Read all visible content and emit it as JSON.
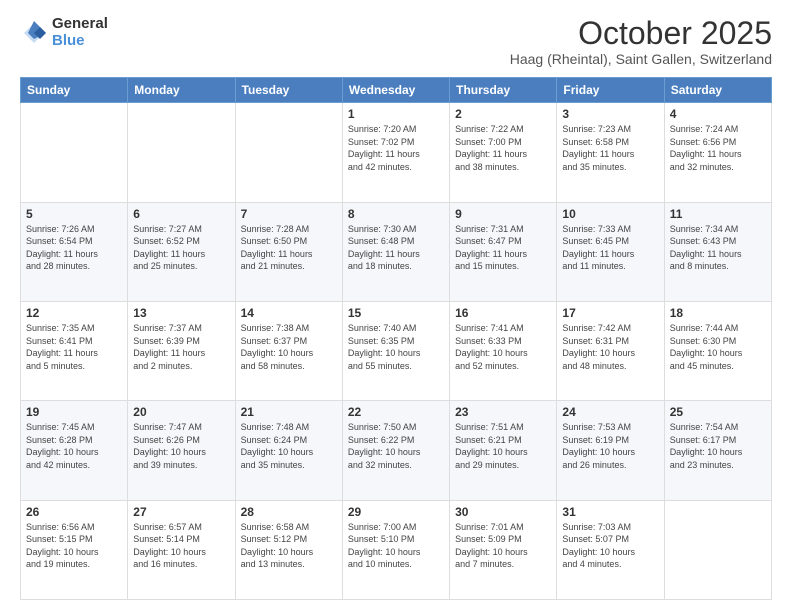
{
  "logo": {
    "general": "General",
    "blue": "Blue"
  },
  "header": {
    "month": "October 2025",
    "location": "Haag (Rheintal), Saint Gallen, Switzerland"
  },
  "weekdays": [
    "Sunday",
    "Monday",
    "Tuesday",
    "Wednesday",
    "Thursday",
    "Friday",
    "Saturday"
  ],
  "weeks": [
    [
      {
        "day": "",
        "info": ""
      },
      {
        "day": "",
        "info": ""
      },
      {
        "day": "",
        "info": ""
      },
      {
        "day": "1",
        "info": "Sunrise: 7:20 AM\nSunset: 7:02 PM\nDaylight: 11 hours\nand 42 minutes."
      },
      {
        "day": "2",
        "info": "Sunrise: 7:22 AM\nSunset: 7:00 PM\nDaylight: 11 hours\nand 38 minutes."
      },
      {
        "day": "3",
        "info": "Sunrise: 7:23 AM\nSunset: 6:58 PM\nDaylight: 11 hours\nand 35 minutes."
      },
      {
        "day": "4",
        "info": "Sunrise: 7:24 AM\nSunset: 6:56 PM\nDaylight: 11 hours\nand 32 minutes."
      }
    ],
    [
      {
        "day": "5",
        "info": "Sunrise: 7:26 AM\nSunset: 6:54 PM\nDaylight: 11 hours\nand 28 minutes."
      },
      {
        "day": "6",
        "info": "Sunrise: 7:27 AM\nSunset: 6:52 PM\nDaylight: 11 hours\nand 25 minutes."
      },
      {
        "day": "7",
        "info": "Sunrise: 7:28 AM\nSunset: 6:50 PM\nDaylight: 11 hours\nand 21 minutes."
      },
      {
        "day": "8",
        "info": "Sunrise: 7:30 AM\nSunset: 6:48 PM\nDaylight: 11 hours\nand 18 minutes."
      },
      {
        "day": "9",
        "info": "Sunrise: 7:31 AM\nSunset: 6:47 PM\nDaylight: 11 hours\nand 15 minutes."
      },
      {
        "day": "10",
        "info": "Sunrise: 7:33 AM\nSunset: 6:45 PM\nDaylight: 11 hours\nand 11 minutes."
      },
      {
        "day": "11",
        "info": "Sunrise: 7:34 AM\nSunset: 6:43 PM\nDaylight: 11 hours\nand 8 minutes."
      }
    ],
    [
      {
        "day": "12",
        "info": "Sunrise: 7:35 AM\nSunset: 6:41 PM\nDaylight: 11 hours\nand 5 minutes."
      },
      {
        "day": "13",
        "info": "Sunrise: 7:37 AM\nSunset: 6:39 PM\nDaylight: 11 hours\nand 2 minutes."
      },
      {
        "day": "14",
        "info": "Sunrise: 7:38 AM\nSunset: 6:37 PM\nDaylight: 10 hours\nand 58 minutes."
      },
      {
        "day": "15",
        "info": "Sunrise: 7:40 AM\nSunset: 6:35 PM\nDaylight: 10 hours\nand 55 minutes."
      },
      {
        "day": "16",
        "info": "Sunrise: 7:41 AM\nSunset: 6:33 PM\nDaylight: 10 hours\nand 52 minutes."
      },
      {
        "day": "17",
        "info": "Sunrise: 7:42 AM\nSunset: 6:31 PM\nDaylight: 10 hours\nand 48 minutes."
      },
      {
        "day": "18",
        "info": "Sunrise: 7:44 AM\nSunset: 6:30 PM\nDaylight: 10 hours\nand 45 minutes."
      }
    ],
    [
      {
        "day": "19",
        "info": "Sunrise: 7:45 AM\nSunset: 6:28 PM\nDaylight: 10 hours\nand 42 minutes."
      },
      {
        "day": "20",
        "info": "Sunrise: 7:47 AM\nSunset: 6:26 PM\nDaylight: 10 hours\nand 39 minutes."
      },
      {
        "day": "21",
        "info": "Sunrise: 7:48 AM\nSunset: 6:24 PM\nDaylight: 10 hours\nand 35 minutes."
      },
      {
        "day": "22",
        "info": "Sunrise: 7:50 AM\nSunset: 6:22 PM\nDaylight: 10 hours\nand 32 minutes."
      },
      {
        "day": "23",
        "info": "Sunrise: 7:51 AM\nSunset: 6:21 PM\nDaylight: 10 hours\nand 29 minutes."
      },
      {
        "day": "24",
        "info": "Sunrise: 7:53 AM\nSunset: 6:19 PM\nDaylight: 10 hours\nand 26 minutes."
      },
      {
        "day": "25",
        "info": "Sunrise: 7:54 AM\nSunset: 6:17 PM\nDaylight: 10 hours\nand 23 minutes."
      }
    ],
    [
      {
        "day": "26",
        "info": "Sunrise: 6:56 AM\nSunset: 5:15 PM\nDaylight: 10 hours\nand 19 minutes."
      },
      {
        "day": "27",
        "info": "Sunrise: 6:57 AM\nSunset: 5:14 PM\nDaylight: 10 hours\nand 16 minutes."
      },
      {
        "day": "28",
        "info": "Sunrise: 6:58 AM\nSunset: 5:12 PM\nDaylight: 10 hours\nand 13 minutes."
      },
      {
        "day": "29",
        "info": "Sunrise: 7:00 AM\nSunset: 5:10 PM\nDaylight: 10 hours\nand 10 minutes."
      },
      {
        "day": "30",
        "info": "Sunrise: 7:01 AM\nSunset: 5:09 PM\nDaylight: 10 hours\nand 7 minutes."
      },
      {
        "day": "31",
        "info": "Sunrise: 7:03 AM\nSunset: 5:07 PM\nDaylight: 10 hours\nand 4 minutes."
      },
      {
        "day": "",
        "info": ""
      }
    ]
  ]
}
